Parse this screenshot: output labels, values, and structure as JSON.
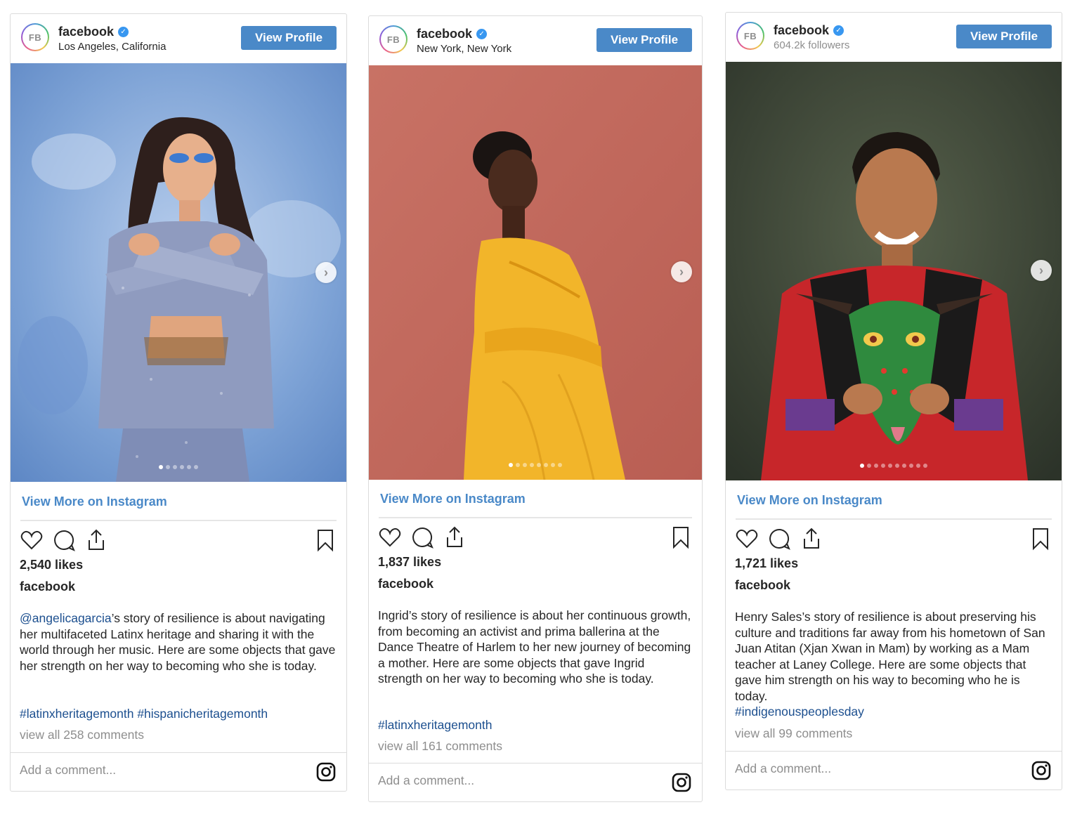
{
  "posts": [
    {
      "avatar_text": "FB",
      "account": "facebook",
      "subline": "Los Angeles, California",
      "view_profile": "View Profile",
      "view_more": "View More on Instagram",
      "likes": "2,540 likes",
      "author": "facebook",
      "mention": "@angelicagarcia",
      "caption": "’s story of resilience is about navigating her multifaceted Latinx heritage and sharing it with the world through her music. Here are some objects that gave her strength on her way to becoming who she is today.",
      "hashtags": "#latinxheritagemonth #hispanicheritagemonth",
      "comments": "view all 258 comments",
      "comment_placeholder": "Add a comment...",
      "carousel": {
        "count": 6,
        "active": 1
      },
      "photo_colors": {
        "bg": "#7ea3d6",
        "accent": "#a9b6d0"
      }
    },
    {
      "avatar_text": "FB",
      "account": "facebook",
      "subline": "New York, New York",
      "view_profile": "View Profile",
      "view_more": "View More on Instagram",
      "likes": "1,837 likes",
      "author": "facebook",
      "caption": "Ingrid’s story of resilience is about her continuous growth, from becoming an activist and prima ballerina at the Dance Theatre of Harlem to her new journey of becoming a mother. Here are some objects that gave Ingrid strength on her way to becoming who she is today.",
      "hashtags": "#latinxheritagemonth",
      "comments": "view all 161 comments",
      "comment_placeholder": "Add a comment...",
      "carousel": {
        "count": 8,
        "active": 1
      },
      "photo_colors": {
        "bg": "#c46a5e",
        "accent": "#f0b52a"
      }
    },
    {
      "avatar_text": "FB",
      "account": "facebook",
      "subline": "604.2k followers",
      "view_profile": "View Profile",
      "view_more": "View More on Instagram",
      "likes": "1,721 likes",
      "author": "facebook",
      "caption": "Henry Sales’s story of resilience is about preserving his culture and traditions far away from his hometown of San Juan Atitan (Xjan Xwan in Mam) by working as a Mam teacher at Laney College. Here are some objects that gave him strength on his way to becoming who he is today.",
      "hashtags": "#indigenouspeoplesday",
      "comments": "view all 99 comments",
      "comment_placeholder": "Add a comment...",
      "carousel": {
        "count": 10,
        "active": 1
      },
      "photo_colors": {
        "bg": "#3f4a3a",
        "accent": "#c7262a"
      }
    }
  ],
  "colors": {
    "button": "#4a89c8",
    "link": "#4a89c8",
    "hashtag": "#1c4f8f",
    "verified": "#3897f0"
  },
  "icons": [
    "verified-badge-icon",
    "chevron-right-icon",
    "heart-icon",
    "comment-icon",
    "share-icon",
    "bookmark-icon",
    "instagram-icon"
  ]
}
